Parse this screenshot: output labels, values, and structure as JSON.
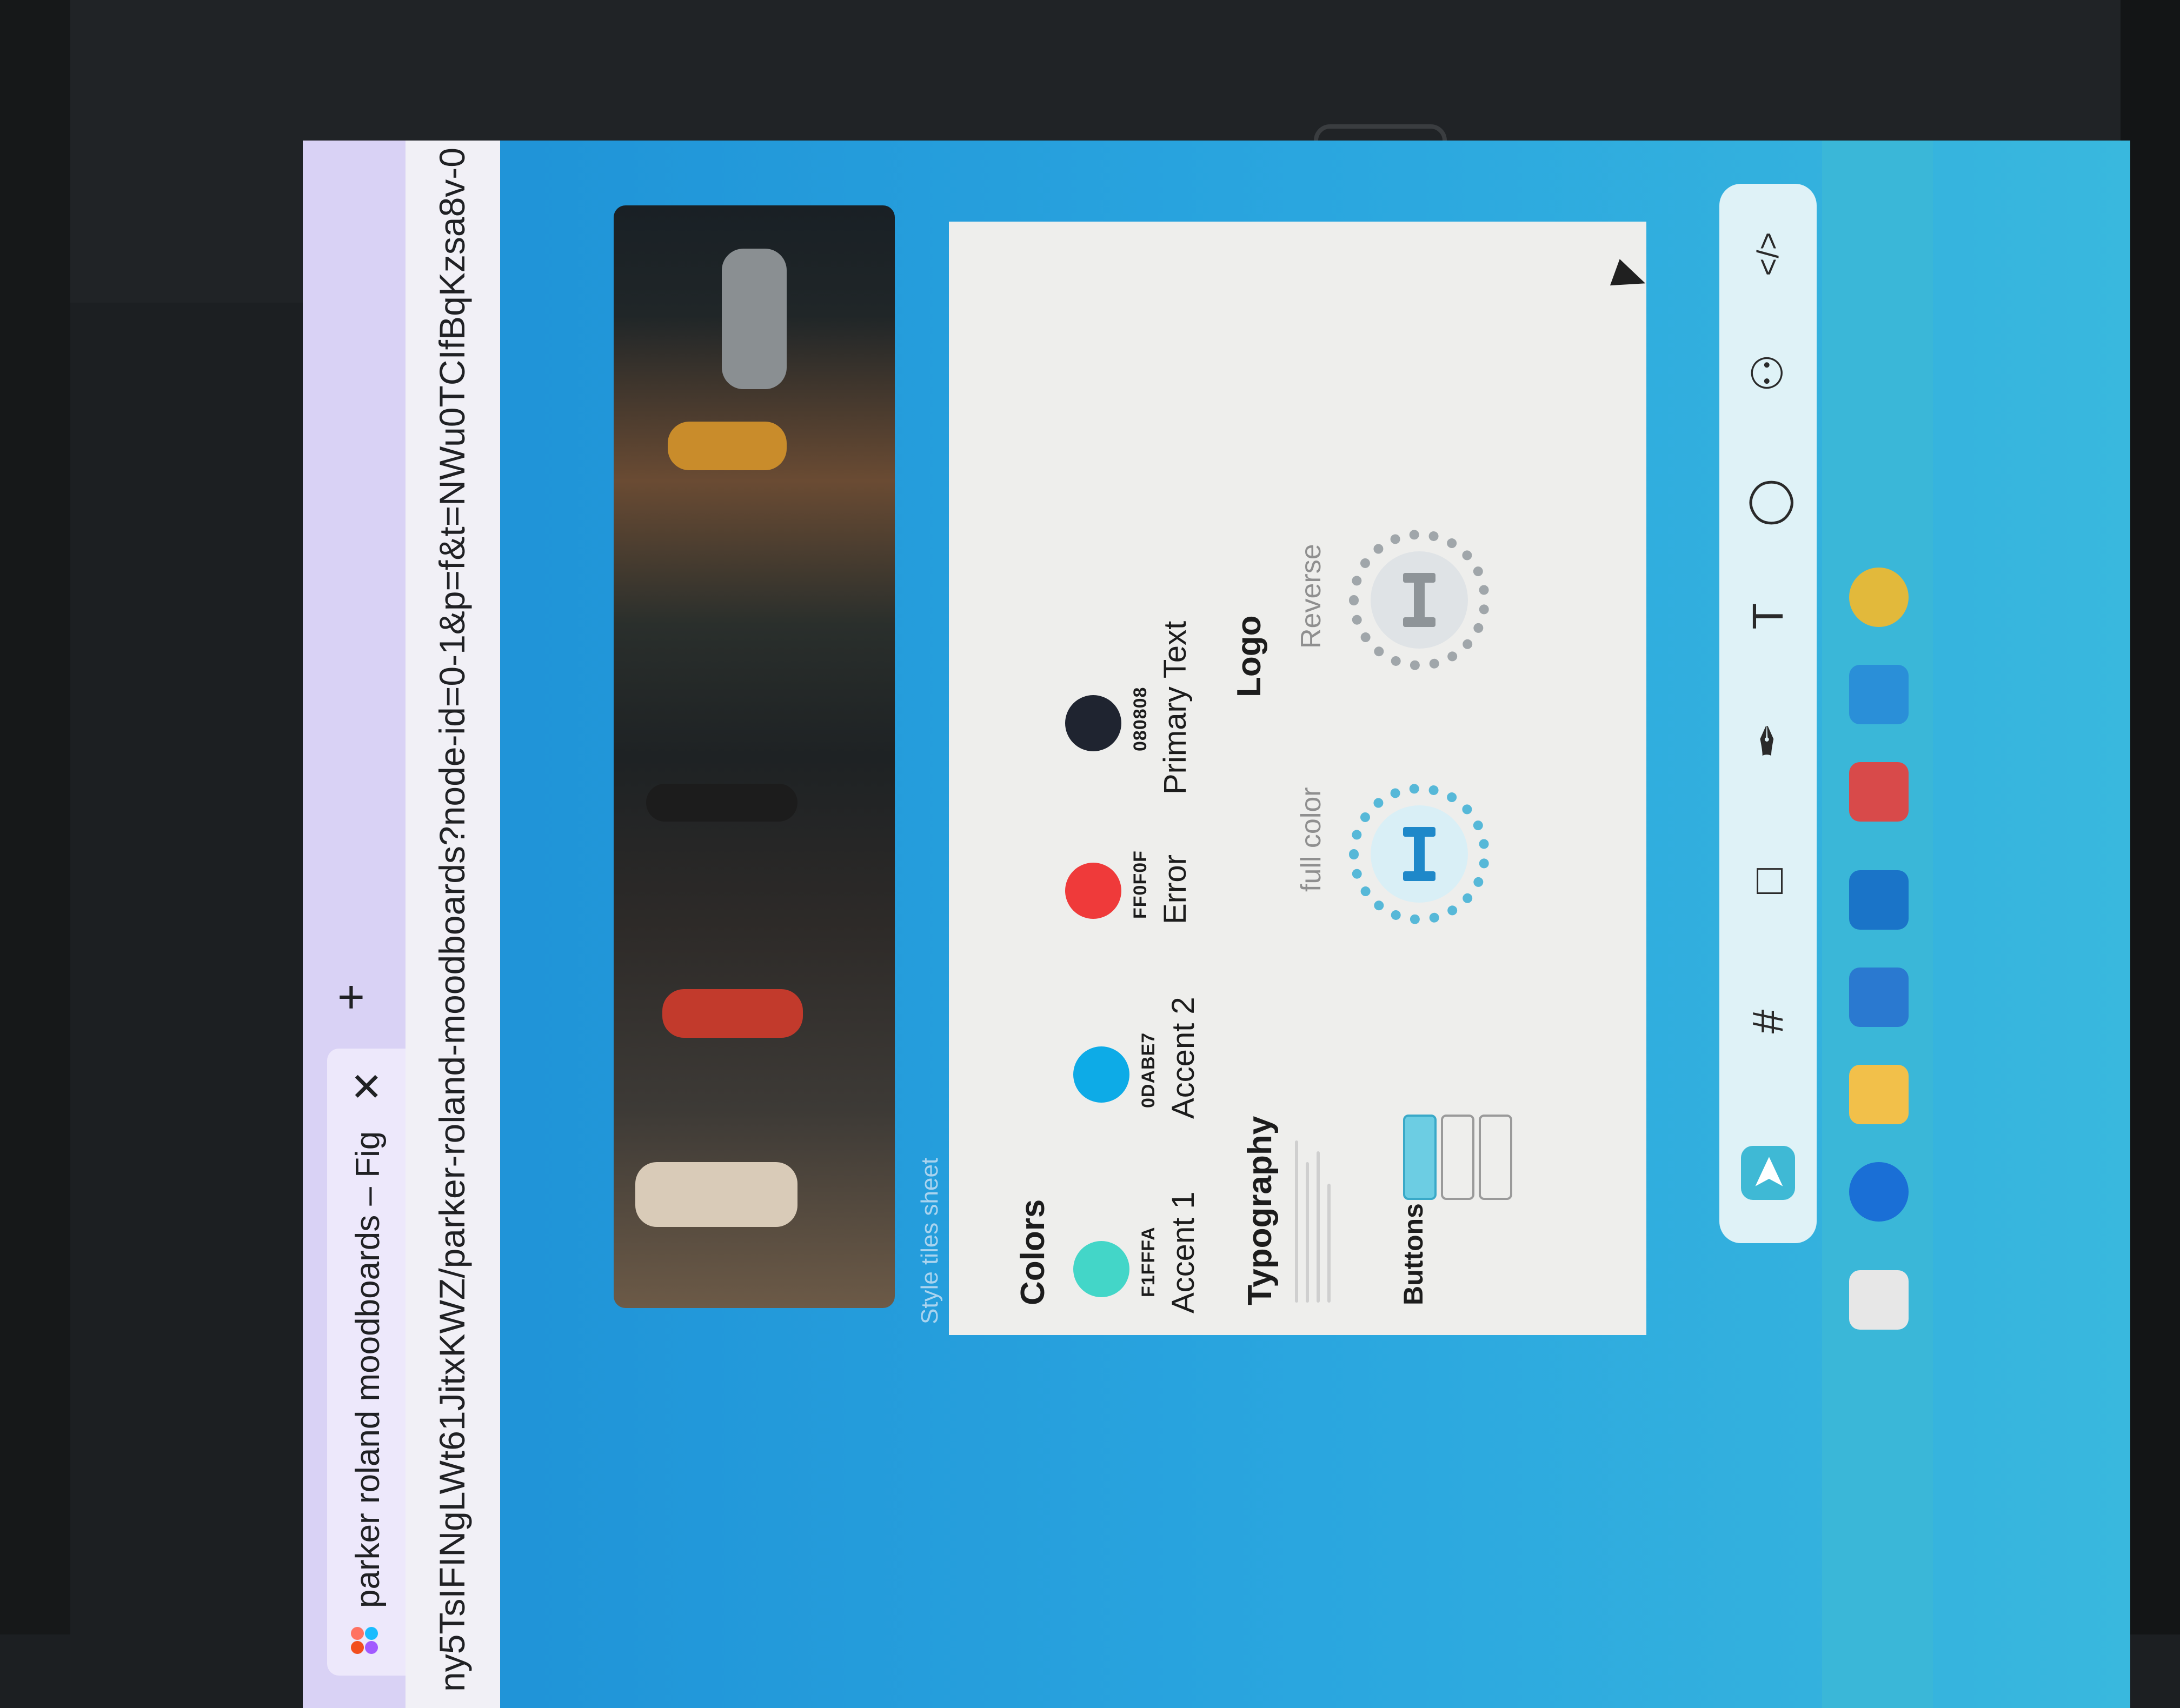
{
  "browser": {
    "tab_title": "parker roland moodboards – Fig",
    "tab_close": "✕",
    "new_tab": "+",
    "url": "ny5TsIFINgLWt61JitxKWZ/parker-roland-moodboards?node-id=0-1&p=f&t=NWu0TCIfBqKzsa8v-0"
  },
  "canvas": {
    "frame_label": "Style tiles sheet"
  },
  "style_tile": {
    "colors_title": "Colors",
    "swatches": [
      {
        "hex": "F1FFFA",
        "label": "Accent 1",
        "color": "#43d6c8"
      },
      {
        "hex": "0DABE7",
        "label": "Accent 2",
        "color": "#0dabe7"
      },
      {
        "hex": "FF0F0F",
        "label": "Error",
        "color": "#ef3a3a"
      },
      {
        "hex": "080808",
        "label": "Primary Text",
        "color": "#1f2430"
      }
    ],
    "typography_title": "Typography",
    "logo_title": "Logo",
    "logo_variants": [
      "full color",
      "Reverse"
    ],
    "buttons_title": "Buttons"
  },
  "toolbar": {
    "tools": [
      "move-tool",
      "frame-tool",
      "shape-tool",
      "pen-tool",
      "text-tool",
      "comment-tool",
      "actions-tool",
      "dev-mode-toggle"
    ],
    "glyphs": [
      "➤",
      "#",
      "□",
      "✒",
      "T",
      "◯",
      "⚇",
      "</>"
    ]
  },
  "colors": {
    "canvas_bg": "#2aa6df",
    "accent": "#3fb9d5"
  }
}
